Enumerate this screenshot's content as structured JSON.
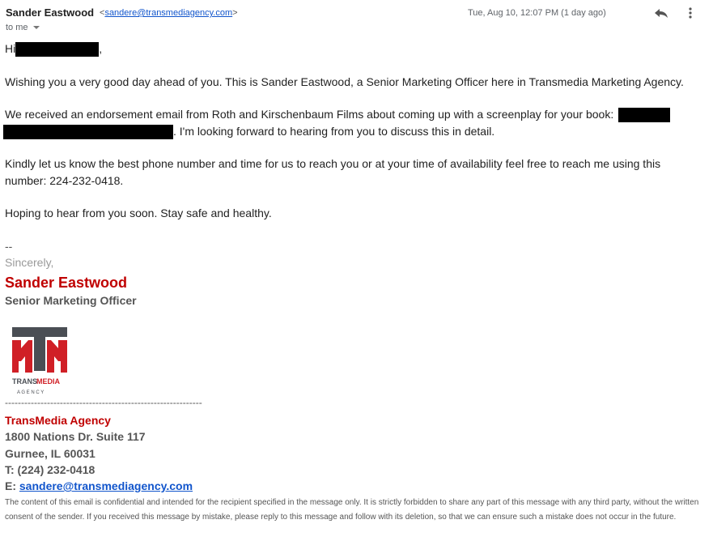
{
  "header": {
    "sender_name": "Sander Eastwood",
    "sender_email_open": "<",
    "sender_email": "sandere@transmediagency.com",
    "sender_email_close": ">",
    "date": "Tue, Aug 10, 12:07 PM (1 day ago)",
    "to_label": "to me",
    "reply_icon": "reply-icon",
    "more_icon": "more-vert-icon"
  },
  "body": {
    "greeting_prefix": "Hi",
    "greeting_suffix": ",",
    "para1": "Wishing you a very good day ahead of you. This is Sander Eastwood, a Senior Marketing Officer here in Transmedia Marketing Agency.",
    "para2_line1": "We received an endorsement email from Roth and Kirschenbaum Films about coming up with a screenplay for your book:",
    "para2_line2": ". I'm looking forward to hearing from you to discuss this in detail.",
    "para3_line1": "Kindly let us know the best phone number and time for us to reach you or at your time of availability feel free to reach me using this",
    "para3_line2": "number: 224-232-0418.",
    "para4": "Hoping to hear from you soon. Stay safe and healthy."
  },
  "signature": {
    "dash": "--",
    "closing": "Sincerely,",
    "name": "Sander Eastwood",
    "title": "Senior Marketing Officer",
    "logo_text_trans": "TRANS",
    "logo_text_media": "MEDIA",
    "logo_text_agency": "A G E N C Y",
    "divider": "-------------------------------------------------------------",
    "agency": "TransMedia Agency",
    "address1": "1800 Nations Dr. Suite 117",
    "address2": "Gurnee, IL 60031",
    "phone": "T: (224) 232-0418",
    "email_label": "E: ",
    "email": "sandere@transmediagency.com",
    "disclaimer": "The content of this email is confidential and intended for the recipient specified in the message only. It is strictly forbidden to share any part of this message with any third party, without the written consent of the sender. If you received this message by mistake, please reply to this message and follow with its deletion, so that we can ensure such a mistake does not occur in the future.",
    "brand_red": "#c00000",
    "logo_gray": "#4a4e54"
  }
}
